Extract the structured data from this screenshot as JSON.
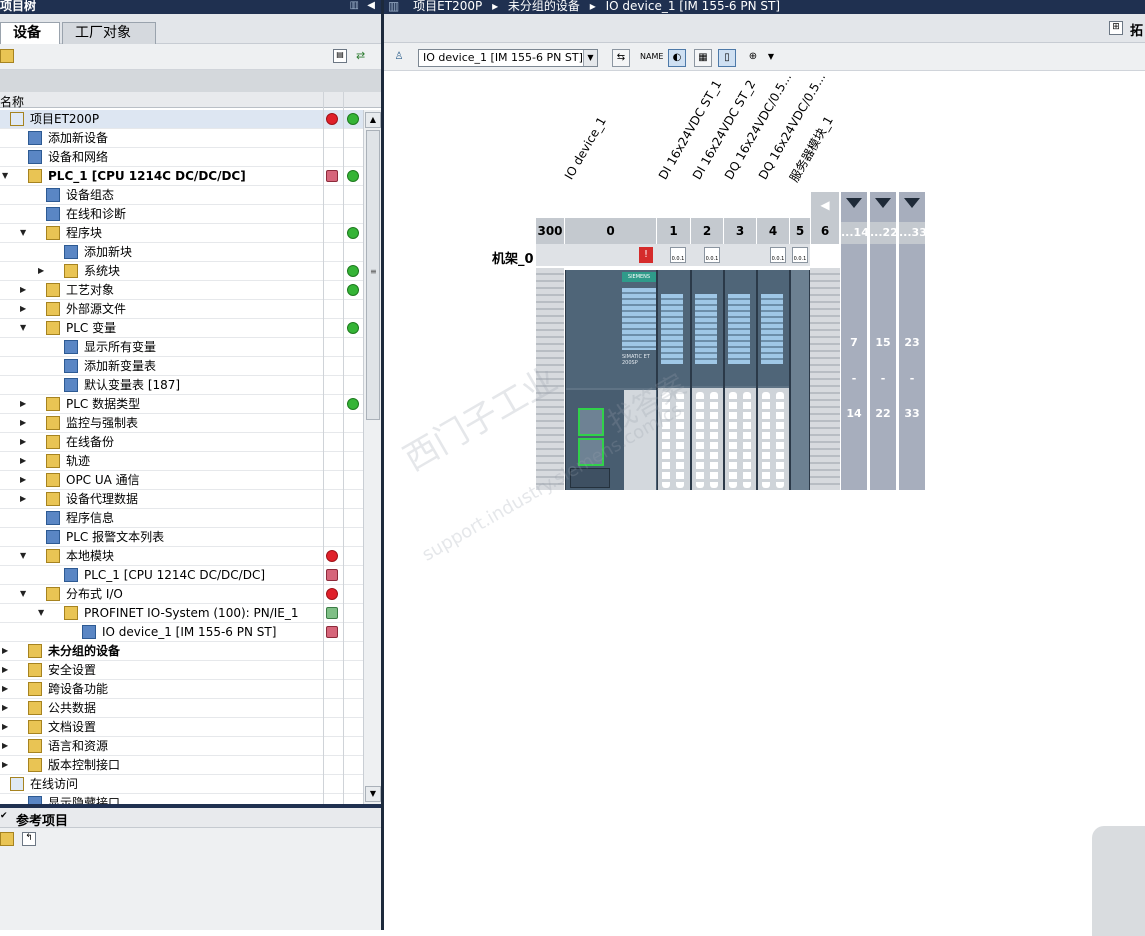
{
  "left_panel": {
    "title": "项目树",
    "tabs": [
      "设备",
      "工厂对象"
    ],
    "column_header": "名称",
    "tree": [
      {
        "indent": 0,
        "exp": "open",
        "label": "项目ET200P",
        "status": "err-dot",
        "status2": "green",
        "sel": true
      },
      {
        "indent": 1,
        "exp": "",
        "label": "添加新设备"
      },
      {
        "indent": 1,
        "exp": "",
        "label": "设备和网络"
      },
      {
        "indent": 1,
        "exp": "open",
        "label": "PLC_1 [CPU 1214C DC/DC/DC]",
        "bold": true,
        "status": "dev",
        "status2": "green"
      },
      {
        "indent": 2,
        "exp": "",
        "label": "设备组态"
      },
      {
        "indent": 2,
        "exp": "",
        "label": "在线和诊断"
      },
      {
        "indent": 2,
        "exp": "open",
        "label": "程序块",
        "status2": "green"
      },
      {
        "indent": 3,
        "exp": "",
        "label": "添加新块"
      },
      {
        "indent": 3,
        "exp": "closed",
        "label": "系统块",
        "status2": "green"
      },
      {
        "indent": 2,
        "exp": "closed",
        "label": "工艺对象",
        "status2": "green"
      },
      {
        "indent": 2,
        "exp": "closed",
        "label": "外部源文件"
      },
      {
        "indent": 2,
        "exp": "open",
        "label": "PLC 变量",
        "status2": "green"
      },
      {
        "indent": 3,
        "exp": "",
        "label": "显示所有变量"
      },
      {
        "indent": 3,
        "exp": "",
        "label": "添加新变量表"
      },
      {
        "indent": 3,
        "exp": "",
        "label": "默认变量表 [187]"
      },
      {
        "indent": 2,
        "exp": "closed",
        "label": "PLC 数据类型",
        "status2": "green"
      },
      {
        "indent": 2,
        "exp": "closed",
        "label": "监控与强制表"
      },
      {
        "indent": 2,
        "exp": "closed",
        "label": "在线备份"
      },
      {
        "indent": 2,
        "exp": "closed",
        "label": "轨迹"
      },
      {
        "indent": 2,
        "exp": "closed",
        "label": "OPC UA 通信"
      },
      {
        "indent": 2,
        "exp": "closed",
        "label": "设备代理数据"
      },
      {
        "indent": 2,
        "exp": "",
        "label": "程序信息"
      },
      {
        "indent": 2,
        "exp": "",
        "label": "PLC 报警文本列表"
      },
      {
        "indent": 2,
        "exp": "open",
        "label": "本地模块",
        "status": "err"
      },
      {
        "indent": 3,
        "exp": "",
        "label": "PLC_1 [CPU 1214C DC/DC/DC]",
        "status": "dev"
      },
      {
        "indent": 2,
        "exp": "open",
        "label": "分布式 I/O",
        "status": "err"
      },
      {
        "indent": 3,
        "exp": "open",
        "label": "PROFINET IO-System (100): PN/IE_1",
        "status": "net"
      },
      {
        "indent": 4,
        "exp": "",
        "label": "IO device_1 [IM 155-6 PN ST]",
        "status": "dev"
      },
      {
        "indent": 1,
        "exp": "closed",
        "label": "未分组的设备",
        "bold": true
      },
      {
        "indent": 1,
        "exp": "closed",
        "label": "安全设置"
      },
      {
        "indent": 1,
        "exp": "closed",
        "label": "跨设备功能"
      },
      {
        "indent": 1,
        "exp": "closed",
        "label": "公共数据"
      },
      {
        "indent": 1,
        "exp": "closed",
        "label": "文档设置"
      },
      {
        "indent": 1,
        "exp": "closed",
        "label": "语言和资源"
      },
      {
        "indent": 1,
        "exp": "closed",
        "label": "版本控制接口"
      },
      {
        "indent": 0,
        "exp": "open",
        "label": "在线访问"
      },
      {
        "indent": 1,
        "exp": "",
        "label": "显示隐藏接口"
      }
    ],
    "reference_title": "参考项目"
  },
  "right_panel": {
    "breadcrumb": [
      "项目ET200P",
      "未分组的设备",
      "IO device_1 [IM 155-6 PN ST]"
    ],
    "device_dropdown": "IO device_1 [IM 155-6 PN ST]",
    "top_right_label": "拓",
    "rack_label": "机架_0",
    "slot_labels": [
      "IO device_1",
      "DI 16x24VDC ST_1",
      "DI 16x24VDC ST_2",
      "DQ 16x24VDC/0.5...",
      "DQ 16x24VDC/0.5...",
      "服务器模块_1"
    ],
    "slot_numbers": [
      "300",
      "0",
      "1",
      "2",
      "3",
      "4",
      "5",
      "6"
    ],
    "extension_columns": [
      {
        "name": "...14",
        "v1": "7",
        "v2": "-",
        "v3": "14"
      },
      {
        "name": "...22",
        "v1": "15",
        "v2": "-",
        "v3": "22"
      },
      {
        "name": "...33",
        "v1": "23",
        "v2": "-",
        "v3": "33"
      }
    ],
    "module_code_text": "0.0.1",
    "siemens_text": "SIEMENS",
    "simatic_text": "SIMATIC ET 200SP",
    "watermark": [
      "西门子工业",
      "找答案",
      "support.industry.siemens.com/cs"
    ]
  }
}
